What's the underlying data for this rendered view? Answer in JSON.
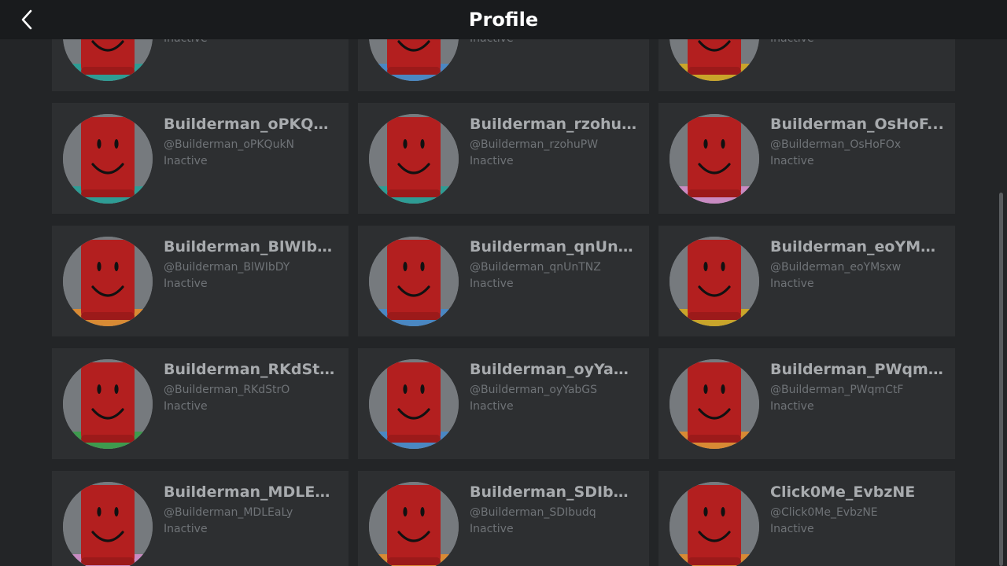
{
  "header": {
    "title": "Profile",
    "back_icon": "chevron-left-icon"
  },
  "friends": [
    {
      "name": "",
      "handle": "",
      "status": "Inactive",
      "shirt_color": "#2e9c94"
    },
    {
      "name": "",
      "handle": "",
      "status": "Inactive",
      "shirt_color": "#4a87c2"
    },
    {
      "name": "",
      "handle": "",
      "status": "Inactive",
      "shirt_color": "#c9a52a"
    },
    {
      "name": "Builderman_oPKQu...",
      "handle": "@Builderman_oPKQukN",
      "status": "Inactive",
      "shirt_color": "#2e9c94"
    },
    {
      "name": "Builderman_rzohuP...",
      "handle": "@Builderman_rzohuPW",
      "status": "Inactive",
      "shirt_color": "#2e9c94"
    },
    {
      "name": "Builderman_OsHoF...",
      "handle": "@Builderman_OsHoFOx",
      "status": "Inactive",
      "shirt_color": "#c98bc2"
    },
    {
      "name": "Builderman_BlWIbDY",
      "handle": "@Builderman_BlWIbDY",
      "status": "Inactive",
      "shirt_color": "#d88a34"
    },
    {
      "name": "Builderman_qnUnT...",
      "handle": "@Builderman_qnUnTNZ",
      "status": "Inactive",
      "shirt_color": "#4a87c2"
    },
    {
      "name": "Builderman_eoYMsx...",
      "handle": "@Builderman_eoYMsxw",
      "status": "Inactive",
      "shirt_color": "#c9a52a"
    },
    {
      "name": "Builderman_RKdStrO",
      "handle": "@Builderman_RKdStrO",
      "status": "Inactive",
      "shirt_color": "#3e9a4e"
    },
    {
      "name": "Builderman_oyYab...",
      "handle": "@Builderman_oyYabGS",
      "status": "Inactive",
      "shirt_color": "#4a87c2"
    },
    {
      "name": "Builderman_PWqm...",
      "handle": "@Builderman_PWqmCtF",
      "status": "Inactive",
      "shirt_color": "#d88a34"
    },
    {
      "name": "Builderman_MDLEaLy",
      "handle": "@Builderman_MDLEaLy",
      "status": "Inactive",
      "shirt_color": "#c98bc2"
    },
    {
      "name": "Builderman_SDIbudq",
      "handle": "@Builderman_SDIbudq",
      "status": "Inactive",
      "shirt_color": "#d88a34"
    },
    {
      "name": "Click0Me_EvbzNE",
      "handle": "@Click0Me_EvbzNE",
      "status": "Inactive",
      "shirt_color": "#d88a34"
    }
  ],
  "colors": {
    "head": "#b31f1f",
    "head_dark": "#9c1a1a",
    "avatar_bg": "#767a7e",
    "card_bg": "#2d2f31",
    "page_bg": "#232527",
    "header_bg": "#191b1d"
  }
}
